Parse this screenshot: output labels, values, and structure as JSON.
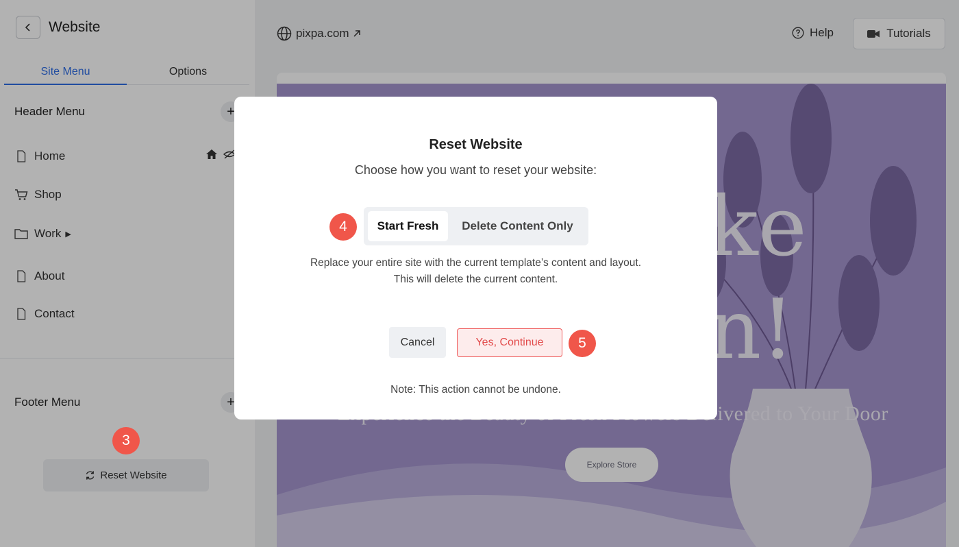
{
  "sidebar": {
    "title": "Website",
    "tabs": [
      {
        "label": "Site Menu"
      },
      {
        "label": "Options"
      }
    ],
    "header_menu": {
      "title": "Header Menu",
      "items": [
        {
          "label": "Home",
          "icon": "page-icon"
        },
        {
          "label": "Shop",
          "icon": "cart-icon"
        },
        {
          "label": "Work",
          "icon": "folder-icon"
        },
        {
          "label": "About",
          "icon": "page-icon"
        },
        {
          "label": "Contact",
          "icon": "page-icon"
        }
      ]
    },
    "footer_menu": {
      "title": "Footer Menu"
    },
    "reset_button": "Reset Website"
  },
  "topbar": {
    "url": "pixpa.com",
    "help": "Help",
    "tutorials": "Tutorials"
  },
  "preview": {
    "partial_word_1": "ke",
    "partial_word_2": "n!",
    "subtitle": "Experience the Beauty of Fresh Flowers Delivered to Your Door",
    "cta": "Explore Store"
  },
  "modal": {
    "title": "Reset Website",
    "subtitle": "Choose how you want to reset your website:",
    "options": [
      {
        "label": "Start Fresh"
      },
      {
        "label": "Delete Content Only"
      }
    ],
    "selected_option": "Start Fresh",
    "description_line1": "Replace your entire site with the current template’s content and layout.",
    "description_line2": "This will delete the current content.",
    "cancel": "Cancel",
    "confirm": "Yes, Continue",
    "note": "Note: This action cannot be undone."
  },
  "badges": [
    "3",
    "4",
    "5"
  ],
  "colors": {
    "accent": "#2f6ee6",
    "badge": "#f0564a",
    "danger": "#e24b4b",
    "hero": "#a596cf"
  }
}
